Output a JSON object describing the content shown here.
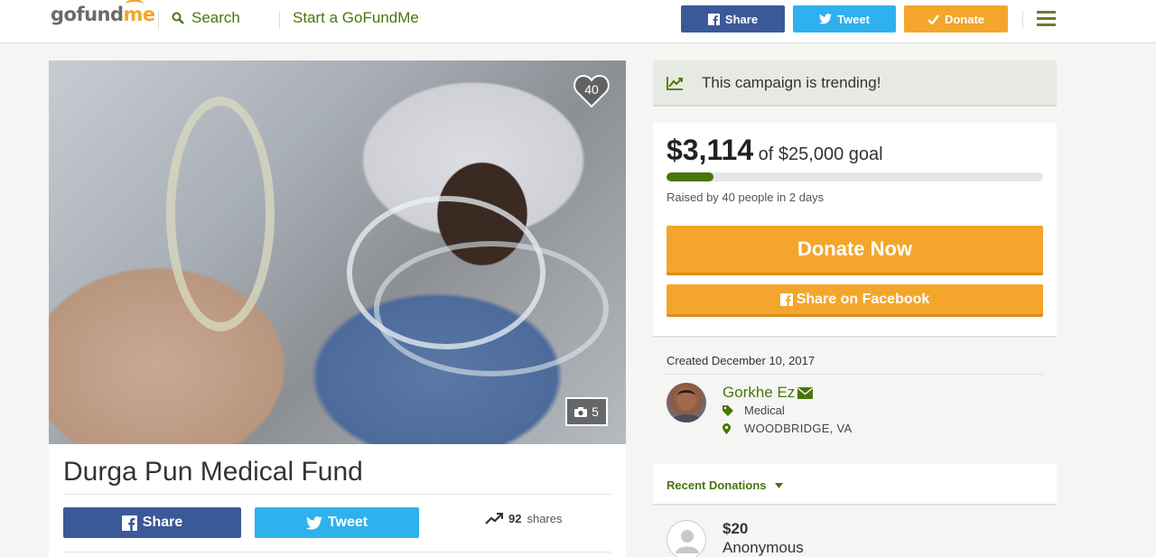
{
  "header": {
    "logo_go": "go",
    "logo_fund": "fund",
    "logo_me": "me",
    "search_label": "Search",
    "start_label": "Start a GoFundMe",
    "share_label": "Share",
    "tweet_label": "Tweet",
    "donate_label": "Donate"
  },
  "photo": {
    "heart_count": "40",
    "photo_count": "5"
  },
  "campaign": {
    "title": "Durga Pun Medical Fund",
    "share_label": "Share",
    "tweet_label": "Tweet",
    "shares_count": "92",
    "shares_label": "shares"
  },
  "sidebar": {
    "trending_text": "This campaign is trending!",
    "raised_amount": "$3,114",
    "of_text": "of",
    "goal_amount": "$25,000",
    "goal_text": "goal",
    "progress_fraction": 0.1246,
    "raised_by": "Raised by 40 people in 2 days",
    "donate_now": "Donate Now",
    "share_facebook": "Share on Facebook",
    "created": "Created December 10, 2017",
    "organizer": "Gorkhe Ez",
    "category": "Medical",
    "location": "WOODBRIDGE, VA",
    "recent_donations": "Recent Donations",
    "donation_amount": "$20",
    "donor_name": "Anonymous"
  },
  "colors": {
    "brand_green": "#49760b",
    "brand_orange": "#f3a62b",
    "facebook": "#3b5998",
    "twitter": "#2fb1ed"
  },
  "icons": [
    "search-icon",
    "facebook-icon",
    "twitter-icon",
    "check-icon",
    "menu-icon",
    "heart-icon",
    "camera-icon",
    "trending-icon",
    "envelope-icon",
    "tag-icon",
    "map-marker-icon",
    "caret-down-icon",
    "anonymous-user-icon"
  ]
}
